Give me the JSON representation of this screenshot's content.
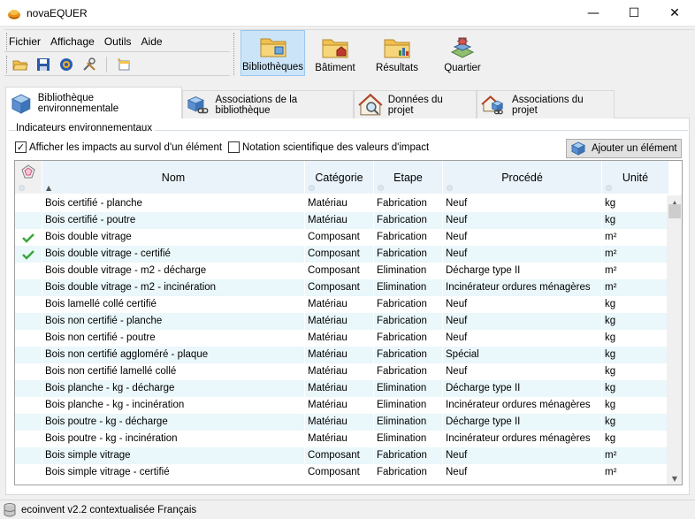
{
  "window": {
    "title": "novaEQUER",
    "minimize_glyph": "—",
    "maximize_glyph": "☐",
    "close_glyph": "✕"
  },
  "menu": [
    "Fichier",
    "Affichage",
    "Outils",
    "Aide"
  ],
  "toolbar_icons": [
    "open-folder-icon",
    "save-icon",
    "settings-icon",
    "tools-icon",
    "new-item-icon"
  ],
  "main_buttons": [
    {
      "label": "Bibliothèques",
      "icon": "library-folder-icon",
      "active": true
    },
    {
      "label": "Bâtiment",
      "icon": "building-folder-icon",
      "active": false
    },
    {
      "label": "Résultats",
      "icon": "results-folder-icon",
      "active": false
    },
    {
      "label": "Quartier",
      "icon": "district-icon",
      "active": false
    }
  ],
  "tabs": [
    {
      "label": "Bibliothèque environnementale",
      "icon": "cube-icon",
      "active": true
    },
    {
      "label": "Associations de la bibliothèque",
      "icon": "cube-link-icon",
      "active": false
    },
    {
      "label": "Données du projet",
      "icon": "house-search-icon",
      "active": false
    },
    {
      "label": "Associations du projet",
      "icon": "house-link-icon",
      "active": false
    }
  ],
  "indicators": {
    "group_label": "Indicateurs environnementaux",
    "show_impacts_label": "Afficher les impacts au survol d'un élément",
    "show_impacts_checked": true,
    "scientific_label": "Notation scientifique des valeurs d'impact",
    "scientific_checked": false,
    "add_button_label": "Ajouter un élément"
  },
  "grid": {
    "columns": [
      "",
      "Nom",
      "Catégorie",
      "Etape",
      "Procédé",
      "Unité"
    ],
    "rows": [
      {
        "check": false,
        "nom": "Bois certifié - planche",
        "categorie": "Matériau",
        "etape": "Fabrication",
        "procede": "Neuf",
        "unite": "kg"
      },
      {
        "check": false,
        "nom": "Bois certifié - poutre",
        "categorie": "Matériau",
        "etape": "Fabrication",
        "procede": "Neuf",
        "unite": "kg"
      },
      {
        "check": true,
        "nom": "Bois double vitrage",
        "categorie": "Composant",
        "etape": "Fabrication",
        "procede": "Neuf",
        "unite": "m²"
      },
      {
        "check": true,
        "nom": "Bois double vitrage - certifié",
        "categorie": "Composant",
        "etape": "Fabrication",
        "procede": "Neuf",
        "unite": "m²"
      },
      {
        "check": false,
        "nom": "Bois double vitrage - m2 - décharge",
        "categorie": "Composant",
        "etape": "Elimination",
        "procede": "Décharge type II",
        "unite": "m²"
      },
      {
        "check": false,
        "nom": "Bois double vitrage - m2 - incinération",
        "categorie": "Composant",
        "etape": "Elimination",
        "procede": "Incinérateur ordures ménagères",
        "unite": "m²"
      },
      {
        "check": false,
        "nom": "Bois lamellé collé certifié",
        "categorie": "Matériau",
        "etape": "Fabrication",
        "procede": "Neuf",
        "unite": "kg"
      },
      {
        "check": false,
        "nom": "Bois non certifié - planche",
        "categorie": "Matériau",
        "etape": "Fabrication",
        "procede": "Neuf",
        "unite": "kg"
      },
      {
        "check": false,
        "nom": "Bois non certifié - poutre",
        "categorie": "Matériau",
        "etape": "Fabrication",
        "procede": "Neuf",
        "unite": "kg"
      },
      {
        "check": false,
        "nom": "Bois non certifié aggloméré - plaque",
        "categorie": "Matériau",
        "etape": "Fabrication",
        "procede": "Spécial",
        "unite": "kg"
      },
      {
        "check": false,
        "nom": "Bois non certifié lamellé collé",
        "categorie": "Matériau",
        "etape": "Fabrication",
        "procede": "Neuf",
        "unite": "kg"
      },
      {
        "check": false,
        "nom": "Bois planche - kg - décharge",
        "categorie": "Matériau",
        "etape": "Elimination",
        "procede": "Décharge type II",
        "unite": "kg"
      },
      {
        "check": false,
        "nom": "Bois planche - kg - incinération",
        "categorie": "Matériau",
        "etape": "Elimination",
        "procede": "Incinérateur ordures ménagères",
        "unite": "kg"
      },
      {
        "check": false,
        "nom": "Bois poutre - kg - décharge",
        "categorie": "Matériau",
        "etape": "Elimination",
        "procede": "Décharge type II",
        "unite": "kg"
      },
      {
        "check": false,
        "nom": "Bois poutre - kg - incinération",
        "categorie": "Matériau",
        "etape": "Elimination",
        "procede": "Incinérateur ordures ménagères",
        "unite": "kg"
      },
      {
        "check": false,
        "nom": "Bois simple vitrage",
        "categorie": "Composant",
        "etape": "Fabrication",
        "procede": "Neuf",
        "unite": "m²"
      },
      {
        "check": false,
        "nom": "Bois simple vitrage - certifié",
        "categorie": "Composant",
        "etape": "Fabrication",
        "procede": "Neuf",
        "unite": "m²"
      }
    ]
  },
  "statusbar": {
    "database": "ecoinvent v2.2 contextualisée Français"
  },
  "colors": {
    "header_bg": "#eaf3fa",
    "alt_row_bg": "#eaf7fb",
    "active_button_bg": "#cce4f7",
    "check_green": "#3aa83a"
  }
}
